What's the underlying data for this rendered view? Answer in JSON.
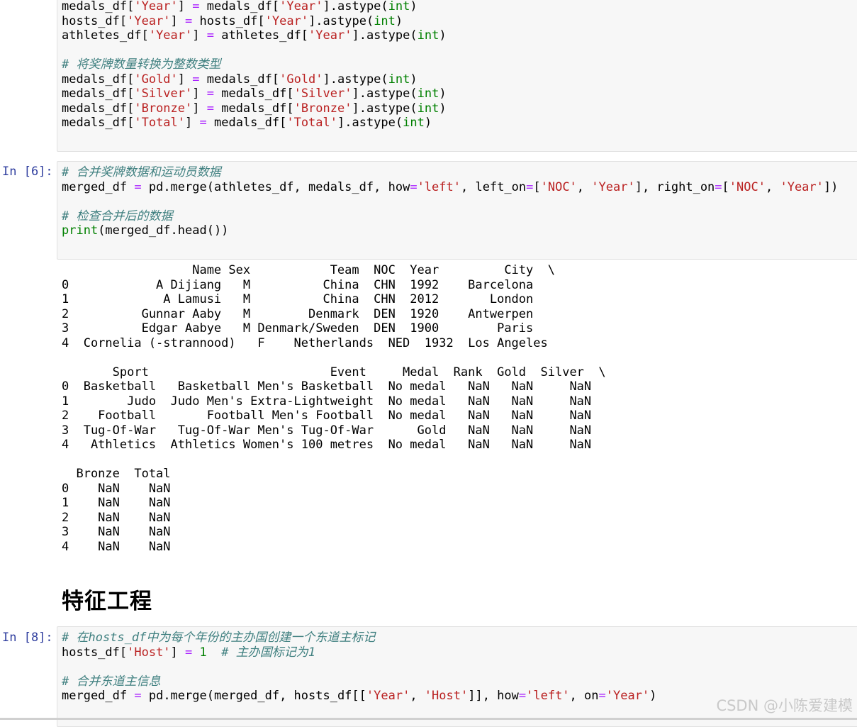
{
  "cells": [
    {
      "prompt": "",
      "lines": [
        [
          [
            "n",
            "medals_df["
          ],
          [
            "s",
            "'Year'"
          ],
          [
            "n",
            "] "
          ],
          [
            "o",
            "="
          ],
          [
            "n",
            " medals_df["
          ],
          [
            "s",
            "'Year'"
          ],
          [
            "n",
            "].astype("
          ],
          [
            "k",
            "int"
          ],
          [
            "n",
            ")"
          ]
        ],
        [
          [
            "n",
            "hosts_df["
          ],
          [
            "s",
            "'Year'"
          ],
          [
            "n",
            "] "
          ],
          [
            "o",
            "="
          ],
          [
            "n",
            " hosts_df["
          ],
          [
            "s",
            "'Year'"
          ],
          [
            "n",
            "].astype("
          ],
          [
            "k",
            "int"
          ],
          [
            "n",
            ")"
          ]
        ],
        [
          [
            "n",
            "athletes_df["
          ],
          [
            "s",
            "'Year'"
          ],
          [
            "n",
            "] "
          ],
          [
            "o",
            "="
          ],
          [
            "n",
            " athletes_df["
          ],
          [
            "s",
            "'Year'"
          ],
          [
            "n",
            "].astype("
          ],
          [
            "k",
            "int"
          ],
          [
            "n",
            ")"
          ]
        ],
        [],
        [
          [
            "c",
            "# 将奖牌数量转换为整数类型"
          ]
        ],
        [
          [
            "n",
            "medals_df["
          ],
          [
            "s",
            "'Gold'"
          ],
          [
            "n",
            "] "
          ],
          [
            "o",
            "="
          ],
          [
            "n",
            " medals_df["
          ],
          [
            "s",
            "'Gold'"
          ],
          [
            "n",
            "].astype("
          ],
          [
            "k",
            "int"
          ],
          [
            "n",
            ")"
          ]
        ],
        [
          [
            "n",
            "medals_df["
          ],
          [
            "s",
            "'Silver'"
          ],
          [
            "n",
            "] "
          ],
          [
            "o",
            "="
          ],
          [
            "n",
            " medals_df["
          ],
          [
            "s",
            "'Silver'"
          ],
          [
            "n",
            "].astype("
          ],
          [
            "k",
            "int"
          ],
          [
            "n",
            ")"
          ]
        ],
        [
          [
            "n",
            "medals_df["
          ],
          [
            "s",
            "'Bronze'"
          ],
          [
            "n",
            "] "
          ],
          [
            "o",
            "="
          ],
          [
            "n",
            " medals_df["
          ],
          [
            "s",
            "'Bronze'"
          ],
          [
            "n",
            "].astype("
          ],
          [
            "k",
            "int"
          ],
          [
            "n",
            ")"
          ]
        ],
        [
          [
            "n",
            "medals_df["
          ],
          [
            "s",
            "'Total'"
          ],
          [
            "n",
            "] "
          ],
          [
            "o",
            "="
          ],
          [
            "n",
            " medals_df["
          ],
          [
            "s",
            "'Total'"
          ],
          [
            "n",
            "].astype("
          ],
          [
            "k",
            "int"
          ],
          [
            "n",
            ")"
          ]
        ]
      ]
    },
    {
      "prompt": "In [6]:",
      "lines": [
        [
          [
            "c",
            "# 合并奖牌数据和运动员数据"
          ]
        ],
        [
          [
            "n",
            "merged_df "
          ],
          [
            "o",
            "="
          ],
          [
            "n",
            " pd.merge(athletes_df, medals_df, how"
          ],
          [
            "o",
            "="
          ],
          [
            "s",
            "'left'"
          ],
          [
            "n",
            ", left_on"
          ],
          [
            "o",
            "="
          ],
          [
            "n",
            "["
          ],
          [
            "s",
            "'NOC'"
          ],
          [
            "n",
            ", "
          ],
          [
            "s",
            "'Year'"
          ],
          [
            "n",
            "], right_on"
          ],
          [
            "o",
            "="
          ],
          [
            "n",
            "["
          ],
          [
            "s",
            "'NOC'"
          ],
          [
            "n",
            ", "
          ],
          [
            "s",
            "'Year'"
          ],
          [
            "n",
            "])"
          ]
        ],
        [],
        [
          [
            "c",
            "# 检查合并后的数据"
          ]
        ],
        [
          [
            "k",
            "print"
          ],
          [
            "n",
            "(merged_df.head())"
          ]
        ]
      ]
    },
    {
      "prompt": "In [8]:",
      "lines": [
        [
          [
            "c",
            "# 在hosts_df中为每个年份的主办国创建一个东道主标记"
          ]
        ],
        [
          [
            "n",
            "hosts_df["
          ],
          [
            "s",
            "'Host'"
          ],
          [
            "n",
            "] "
          ],
          [
            "o",
            "="
          ],
          [
            "n",
            " "
          ],
          [
            "k",
            "1"
          ],
          [
            "n",
            "  "
          ],
          [
            "c",
            "# 主办国标记为1"
          ]
        ],
        [],
        [
          [
            "c",
            "# 合并东道主信息"
          ]
        ],
        [
          [
            "n",
            "merged_df "
          ],
          [
            "o",
            "="
          ],
          [
            "n",
            " pd.merge(merged_df, hosts_df[["
          ],
          [
            "s",
            "'Year'"
          ],
          [
            "n",
            ", "
          ],
          [
            "s",
            "'Host'"
          ],
          [
            "n",
            "]], how"
          ],
          [
            "o",
            "="
          ],
          [
            "s",
            "'left'"
          ],
          [
            "n",
            ", on"
          ],
          [
            "o",
            "="
          ],
          [
            "s",
            "'Year'"
          ],
          [
            "n",
            ")"
          ]
        ]
      ]
    }
  ],
  "output_lines": [
    "                  Name Sex           Team  NOC  Year         City  \\",
    "0            A Dijiang   M          China  CHN  1992    Barcelona   ",
    "1             A Lamusi   M          China  CHN  2012       London   ",
    "2          Gunnar Aaby   M        Denmark  DEN  1920    Antwerpen   ",
    "3          Edgar Aabye   M Denmark/Sweden  DEN  1900        Paris   ",
    "4  Cornelia (-strannood)   F    Netherlands  NED  1932  Los Angeles   ",
    "",
    "       Sport                         Event     Medal  Rank  Gold  Silver  \\",
    "0  Basketball   Basketball Men's Basketball  No medal   NaN   NaN     NaN   ",
    "1        Judo  Judo Men's Extra-Lightweight  No medal   NaN   NaN     NaN   ",
    "2    Football       Football Men's Football  No medal   NaN   NaN     NaN   ",
    "3  Tug-Of-War   Tug-Of-War Men's Tug-Of-War      Gold   NaN   NaN     NaN   ",
    "4   Athletics  Athletics Women's 100 metres  No medal   NaN   NaN     NaN   ",
    "",
    "  Bronze  Total  ",
    "0    NaN    NaN  ",
    "1    NaN    NaN  ",
    "2    NaN    NaN  ",
    "3    NaN    NaN  ",
    "4    NaN    NaN  "
  ],
  "heading": "特征工程",
  "watermark": "CSDN @小陈爱建模"
}
